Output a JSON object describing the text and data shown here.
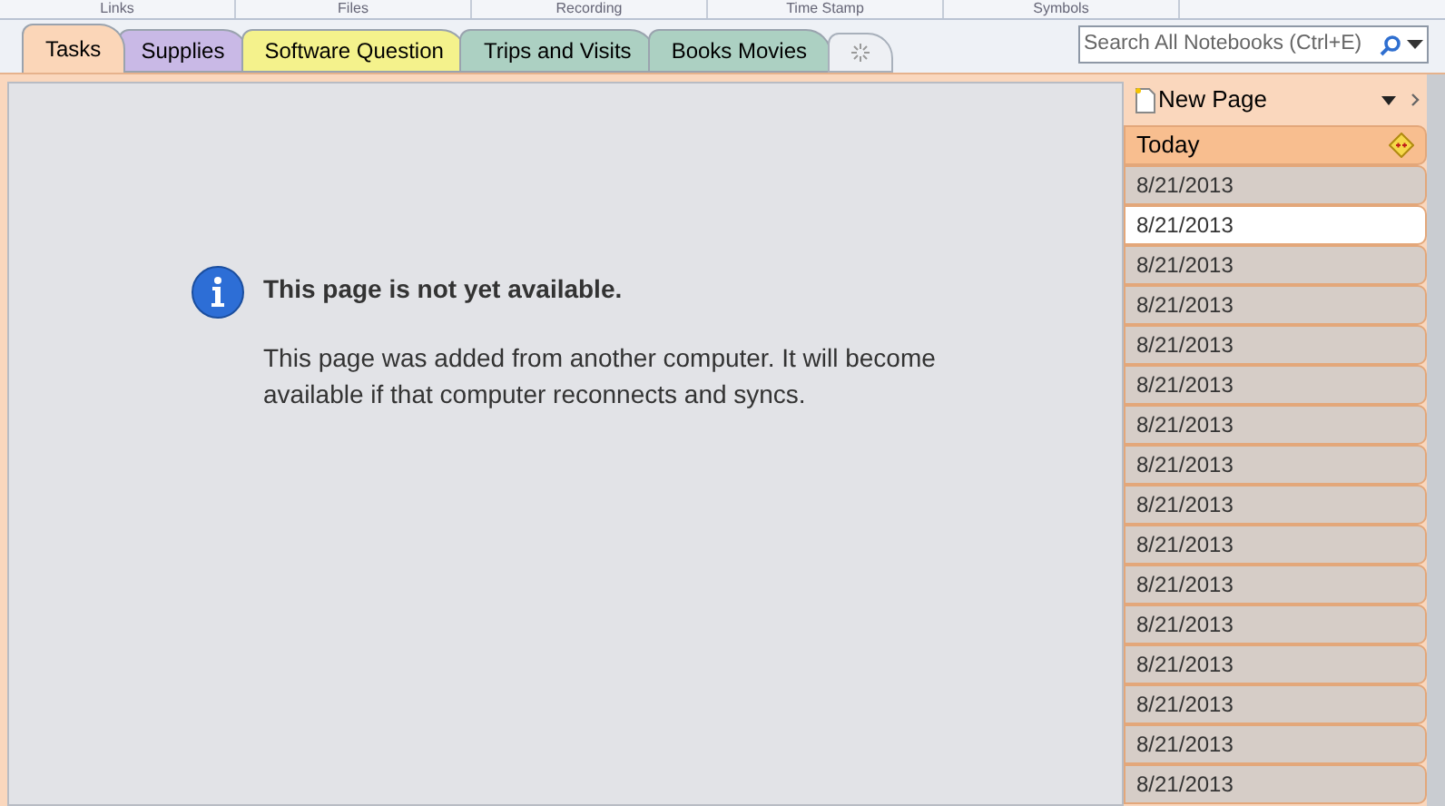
{
  "ribbon_groups": [
    "Links",
    "Files",
    "Recording",
    "Time Stamp",
    "Symbols"
  ],
  "section_tabs": [
    {
      "label": "Tasks",
      "selected": true,
      "color": "#fbd6b8"
    },
    {
      "label": "Supplies",
      "selected": false,
      "color": "#c9b9e6"
    },
    {
      "label": "Software Question",
      "selected": false,
      "color": "#f4f28c"
    },
    {
      "label": "Trips and Visits",
      "selected": false,
      "color": "#acd0c2"
    },
    {
      "label": "Books Movies",
      "selected": false,
      "color": "#acd0c2"
    }
  ],
  "search": {
    "placeholder": "Search All Notebooks (Ctrl+E)"
  },
  "message": {
    "title": "This page is not yet available.",
    "body": "This page was added from another computer. It will become available if that computer reconnects and syncs."
  },
  "page_list": {
    "new_page": "New Page",
    "group": "Today",
    "pages": [
      {
        "title": "8/21/2013",
        "selected": false
      },
      {
        "title": "8/21/2013",
        "selected": true
      },
      {
        "title": "8/21/2013",
        "selected": false
      },
      {
        "title": "8/21/2013",
        "selected": false
      },
      {
        "title": "8/21/2013",
        "selected": false
      },
      {
        "title": "8/21/2013",
        "selected": false
      },
      {
        "title": "8/21/2013",
        "selected": false
      },
      {
        "title": "8/21/2013",
        "selected": false
      },
      {
        "title": "8/21/2013",
        "selected": false
      },
      {
        "title": "8/21/2013",
        "selected": false
      },
      {
        "title": "8/21/2013",
        "selected": false
      },
      {
        "title": "8/21/2013",
        "selected": false
      },
      {
        "title": "8/21/2013",
        "selected": false
      },
      {
        "title": "8/21/2013",
        "selected": false
      },
      {
        "title": "8/21/2013",
        "selected": false
      },
      {
        "title": "8/21/2013",
        "selected": false
      }
    ]
  }
}
